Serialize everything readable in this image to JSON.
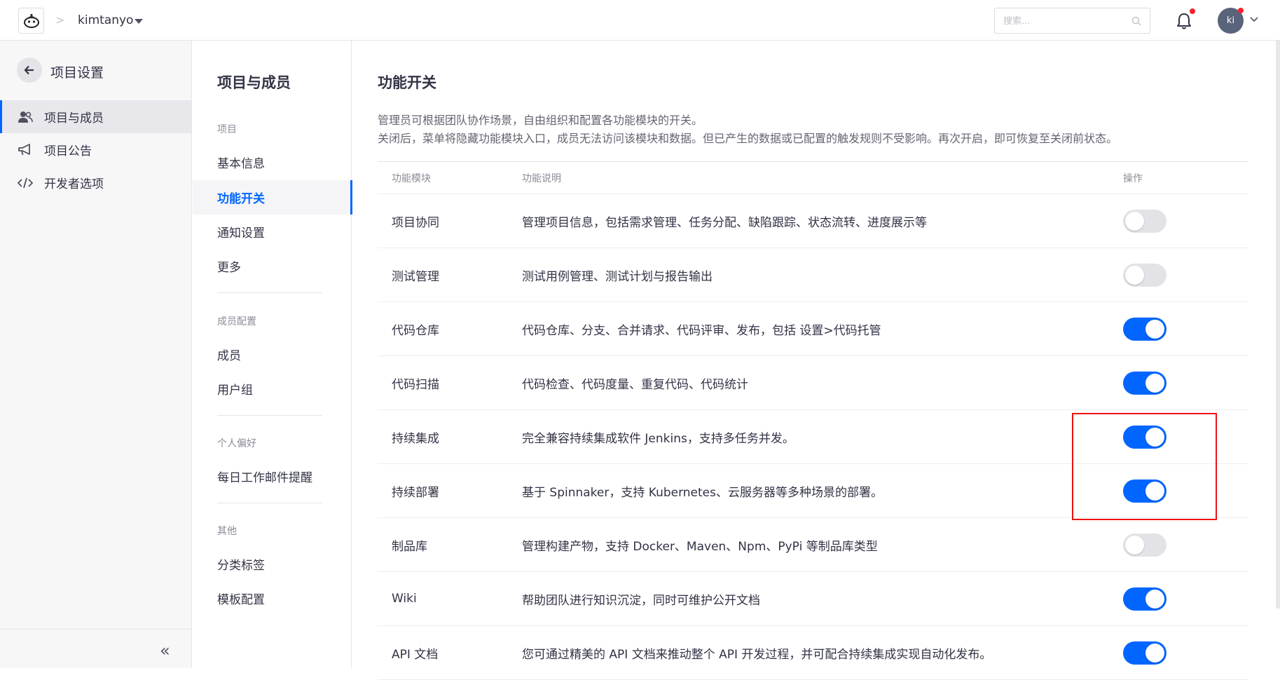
{
  "topbar": {
    "project_name": "kimtanyo",
    "search_placeholder": "搜索...",
    "avatar_initials": "ki"
  },
  "sidebar": {
    "title": "项目设置",
    "items": [
      {
        "label": "项目与成员",
        "icon": "members-icon",
        "active": true
      },
      {
        "label": "项目公告",
        "icon": "megaphone-icon",
        "active": false
      },
      {
        "label": "开发者选项",
        "icon": "code-icon",
        "active": false
      }
    ],
    "collapse_glyph": "«"
  },
  "subnav": {
    "title": "项目与成员",
    "groups": [
      {
        "label": "项目",
        "items": [
          "基本信息",
          "功能开关",
          "通知设置",
          "更多"
        ]
      },
      {
        "label": "成员配置",
        "items": [
          "成员",
          "用户组"
        ]
      },
      {
        "label": "个人偏好",
        "items": [
          "每日工作邮件提醒"
        ]
      },
      {
        "label": "其他",
        "items": [
          "分类标签",
          "模板配置"
        ]
      }
    ],
    "active_item": "功能开关"
  },
  "main": {
    "title": "功能开关",
    "description_lines": [
      "管理员可根据团队协作场景，自由组织和配置各功能模块的开关。",
      "关闭后，菜单将隐藏功能模块入口，成员无法访问该模块和数据。但已产生的数据或已配置的触发规则不受影响。再次开启，即可恢复至关闭前状态。"
    ],
    "table": {
      "headers": [
        "功能模块",
        "功能说明",
        "操作"
      ],
      "rows": [
        {
          "module": "项目协同",
          "desc": "管理项目信息，包括需求管理、任务分配、缺陷跟踪、状态流转、进度展示等",
          "enabled": false
        },
        {
          "module": "测试管理",
          "desc": "测试用例管理、测试计划与报告输出",
          "enabled": false
        },
        {
          "module": "代码仓库",
          "desc": "代码仓库、分支、合并请求、代码评审、发布，包括 设置>代码托管",
          "enabled": true
        },
        {
          "module": "代码扫描",
          "desc": "代码检查、代码度量、重复代码、代码统计",
          "enabled": true
        },
        {
          "module": "持续集成",
          "desc": "完全兼容持续集成软件 Jenkins，支持多任务并发。",
          "enabled": true
        },
        {
          "module": "持续部署",
          "desc": "基于 Spinnaker，支持 Kubernetes、云服务器等多种场景的部署。",
          "enabled": true
        },
        {
          "module": "制品库",
          "desc": "管理构建产物，支持 Docker、Maven、Npm、PyPi 等制品库类型",
          "enabled": false
        },
        {
          "module": "Wiki",
          "desc": "帮助团队进行知识沉淀，同时可维护公开文档",
          "enabled": true
        },
        {
          "module": "API 文档",
          "desc": "您可通过精美的 API 文档来推动整个 API 开发过程，并可配合持续集成实现自动化发布。",
          "enabled": true
        }
      ]
    }
  },
  "colors": {
    "accent": "#0066ff",
    "toggle_off": "#e3e3e7",
    "highlight_box": "#ee1111",
    "notification_dot": "#f5222d"
  }
}
